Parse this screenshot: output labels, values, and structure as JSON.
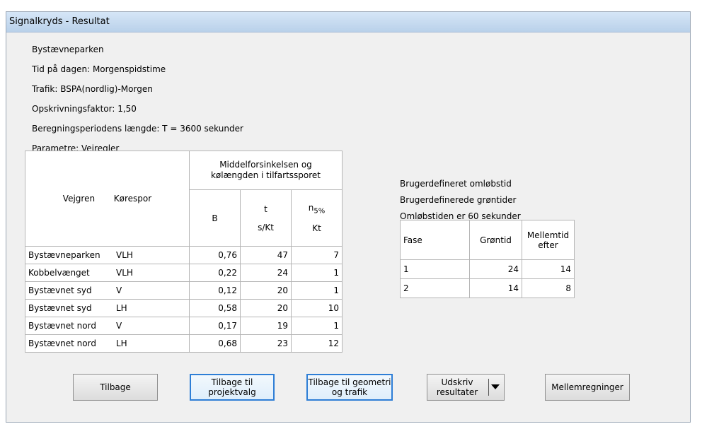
{
  "window": {
    "title": "Signalkryds - Resultat"
  },
  "info": {
    "place": "Bystævneparken",
    "time_of_day": "Tid på dagen:  Morgenspidstime",
    "traffic": "Trafik:  BSPA(nordlig)-Morgen",
    "factor": "Opskrivningsfaktor:   1,50",
    "period": "Beregningsperiodens længde:  T  =  3600  sekunder",
    "params": "Parametre: Vejregler"
  },
  "results": {
    "hdr_vejgren": "Vejgren",
    "hdr_korespor": "Kørespor",
    "hdr_group": "Middelforsinkelsen og kølængden i tilfartssporet",
    "hdr_b": "B",
    "hdr_t": "t",
    "hdr_t_unit": "s/Kt",
    "hdr_n": "n",
    "hdr_n_sub": "5%",
    "hdr_n_unit": "Kt",
    "rows": [
      {
        "vejgren": "Bystævneparken",
        "korespor": "VLH",
        "b": "0,76",
        "t": "47",
        "n": "7"
      },
      {
        "vejgren": "Kobbelvænget",
        "korespor": "VLH",
        "b": "0,22",
        "t": "24",
        "n": "1"
      },
      {
        "vejgren": "Bystævnet syd",
        "korespor": "V",
        "b": "0,12",
        "t": "20",
        "n": "1"
      },
      {
        "vejgren": "Bystævnet syd",
        "korespor": "LH",
        "b": "0,58",
        "t": "20",
        "n": "10"
      },
      {
        "vejgren": "Bystævnet nord",
        "korespor": "V",
        "b": "0,17",
        "t": "19",
        "n": "1"
      },
      {
        "vejgren": "Bystævnet nord",
        "korespor": "LH",
        "b": "0,68",
        "t": "23",
        "n": "12"
      }
    ]
  },
  "cycle": {
    "line1": "Brugerdefineret omløbstid",
    "line2": "Brugerdefinerede grøntider",
    "line3": "Omløbstiden er 60 sekunder"
  },
  "phases": {
    "hdr_fase": "Fase",
    "hdr_green": "Grøntid",
    "hdr_inter": "Mellemtid efter",
    "rows": [
      {
        "fase": "1",
        "green": "24",
        "inter": "14"
      },
      {
        "fase": "2",
        "green": "14",
        "inter": "8"
      }
    ]
  },
  "buttons": {
    "back": "Tilbage",
    "back_project": "Tilbage til projektvalg",
    "back_geometry": "Tilbage til geometri og trafik",
    "print": "Udskriv resultater",
    "intermediate": "Mellemregninger"
  }
}
